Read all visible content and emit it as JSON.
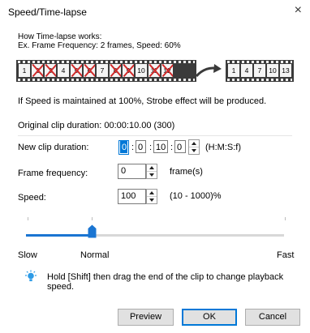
{
  "dialog": {
    "title": "Speed/Time-lapse",
    "close_glyph": "×"
  },
  "info": {
    "line1": "How Time-lapse works:",
    "line2": "Ex. Frame Frequency: 2 frames, Speed: 60%",
    "strobe_note": "If Speed is maintained at 100%, Strobe effect will be produced."
  },
  "film": {
    "source_frames": [
      {
        "label": "1",
        "skipped": false
      },
      {
        "label": "2",
        "skipped": true
      },
      {
        "label": "3",
        "skipped": true
      },
      {
        "label": "4",
        "skipped": false
      },
      {
        "label": "5",
        "skipped": true
      },
      {
        "label": "6",
        "skipped": true
      },
      {
        "label": "7",
        "skipped": false
      },
      {
        "label": "8",
        "skipped": true
      },
      {
        "label": "9",
        "skipped": true
      },
      {
        "label": "10",
        "skipped": false
      },
      {
        "label": "11",
        "skipped": true
      },
      {
        "label": "12",
        "skipped": true
      }
    ],
    "result_frames": [
      "1",
      "4",
      "7",
      "10",
      "13"
    ],
    "skip_color": "#d12a2a"
  },
  "clip": {
    "original_label": "Original clip duration: 00:00:10.00 (300)"
  },
  "new_duration": {
    "label": "New clip duration:",
    "hours": "0",
    "minutes": "0",
    "seconds": "10",
    "frames": "0",
    "separator": ":",
    "format_hint": "(H:M:S:f)"
  },
  "frame_frequency": {
    "label": "Frame frequency:",
    "value": "0",
    "unit": "frame(s)"
  },
  "speed": {
    "label": "Speed:",
    "value": "100",
    "range_hint": "(10 - 1000)%"
  },
  "slider": {
    "min_label": "Slow",
    "mid_label": "Normal",
    "max_label": "Fast",
    "accent_color": "#1a75d2"
  },
  "tip": {
    "icon": "lightbulb-icon",
    "text": "Hold [Shift] then drag the end of the clip to change playback speed."
  },
  "buttons": {
    "preview": "Preview",
    "ok": "OK",
    "cancel": "Cancel"
  }
}
